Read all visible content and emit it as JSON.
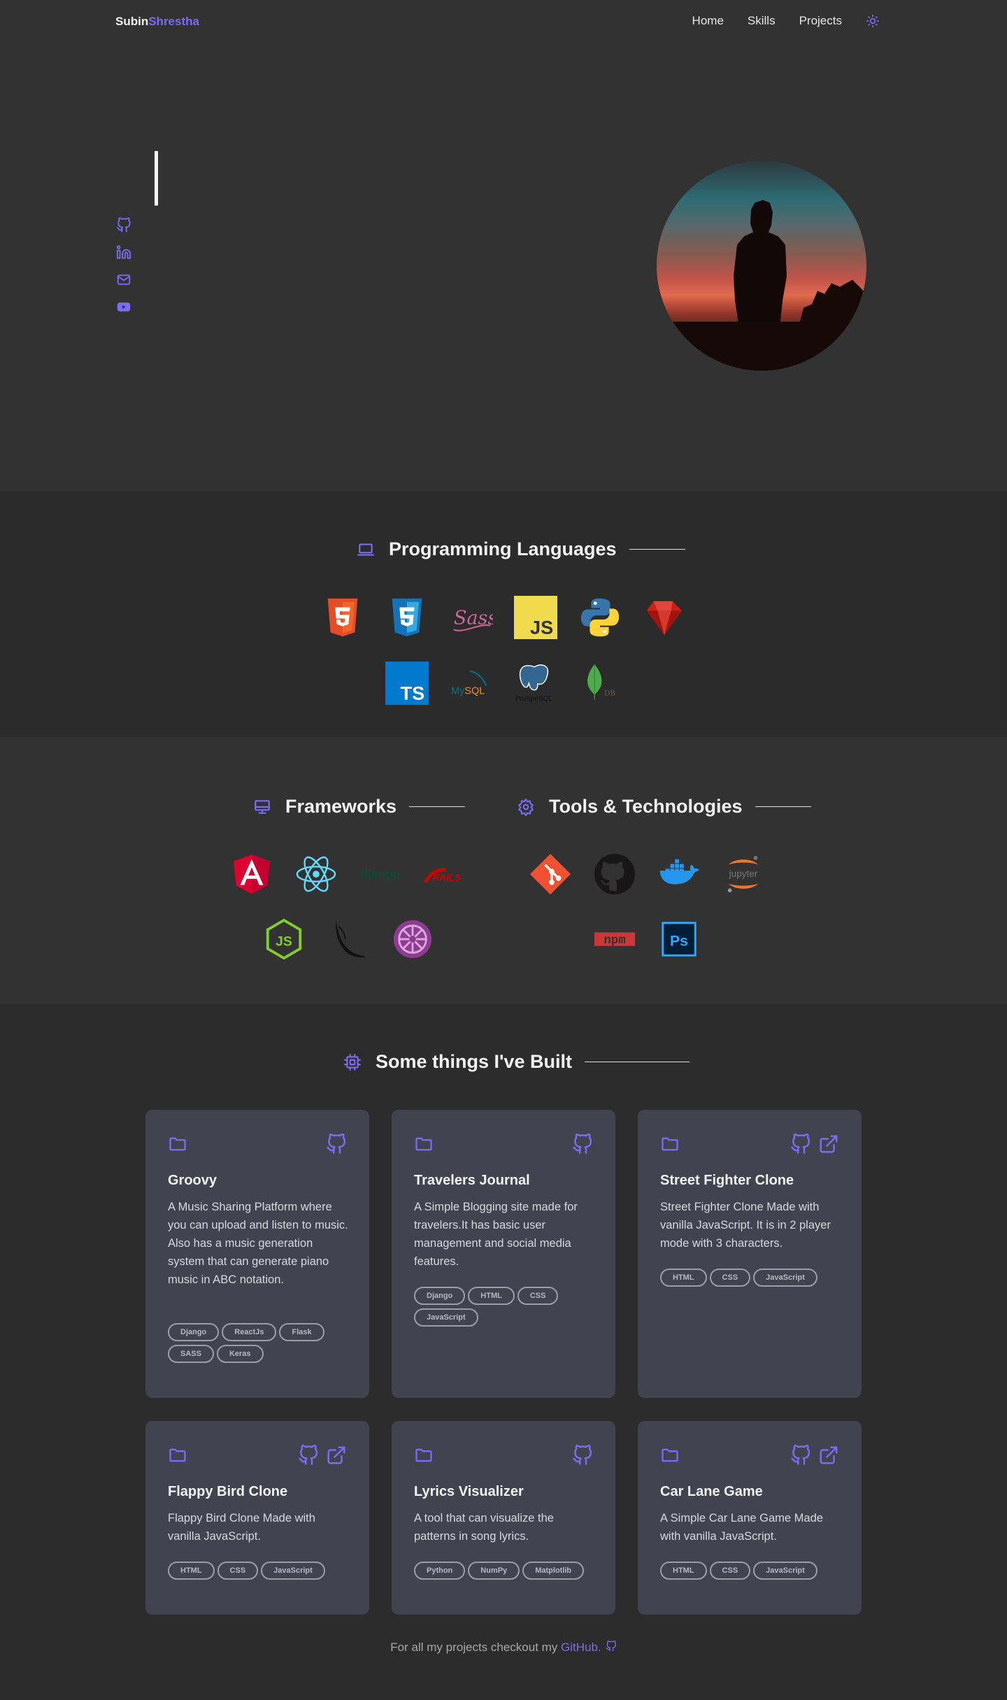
{
  "brand": {
    "first": "Subin",
    "last": "Shrestha"
  },
  "nav": {
    "items": [
      {
        "label": "Home"
      },
      {
        "label": "Skills"
      },
      {
        "label": "Projects"
      }
    ],
    "theme_icon": "sun-icon"
  },
  "hero": {
    "socials": [
      {
        "icon": "github-icon"
      },
      {
        "icon": "linkedin-icon"
      },
      {
        "icon": "mail-icon"
      },
      {
        "icon": "youtube-icon"
      }
    ]
  },
  "sections": {
    "languages": {
      "title": "Programming Languages",
      "icon": "laptop-icon",
      "logos": [
        "html5-logo",
        "css3-logo",
        "sass-logo",
        "javascript-logo",
        "python-logo",
        "ruby-logo",
        "typescript-logo",
        "mysql-logo",
        "postgresql-logo",
        "mongodb-logo"
      ]
    },
    "frameworks": {
      "title": "Frameworks",
      "icon": "desktop-icon",
      "logos": [
        "angular-logo",
        "react-logo",
        "django-logo",
        "rails-logo",
        "nodejs-logo",
        "flask-logo",
        "keras-logo"
      ]
    },
    "tools": {
      "title": "Tools & Technologies",
      "icon": "gear-icon",
      "logos": [
        "git-logo",
        "github-logo",
        "docker-logo",
        "jupyter-logo",
        "npm-logo",
        "photoshop-logo"
      ]
    },
    "projects": {
      "title": "Some things I've Built",
      "icon": "chip-icon"
    }
  },
  "logo_text": {
    "sass": "Sass",
    "js": "JS",
    "ts": "TS",
    "mysql_a": "My",
    "mysql_b": "SQL",
    "postgres": "PostgreSQL",
    "mongo": "DB",
    "django": "django",
    "rails": "RAILS",
    "jupyter": "jupyter",
    "npm": "npm",
    "ps": "Ps"
  },
  "projects": [
    {
      "title": "Groovy",
      "desc": "A Music Sharing Platform where you can upload and listen to music. Also has a music generation system that can generate piano music in ABC notation.",
      "tags": [
        "Django",
        "ReactJs",
        "Flask",
        "SASS",
        "Keras"
      ],
      "links": [
        "github-icon"
      ]
    },
    {
      "title": "Travelers Journal",
      "desc": "A Simple Blogging site made for travelers.It has basic user management and social media features.",
      "tags": [
        "Django",
        "HTML",
        "CSS",
        "JavaScript"
      ],
      "links": [
        "github-icon"
      ]
    },
    {
      "title": "Street Fighter Clone",
      "desc": "Street Fighter Clone Made with vanilla JavaScript. It is in 2 player mode with 3 characters.",
      "tags": [
        "HTML",
        "CSS",
        "JavaScript"
      ],
      "links": [
        "github-icon",
        "external-link-icon"
      ]
    },
    {
      "title": "Flappy Bird Clone",
      "desc": "Flappy Bird Clone Made with vanilla JavaScript.",
      "tags": [
        "HTML",
        "CSS",
        "JavaScript"
      ],
      "links": [
        "github-icon",
        "external-link-icon"
      ]
    },
    {
      "title": "Lyrics Visualizer",
      "desc": "A tool that can visualize the patterns in song lyrics.",
      "tags": [
        "Python",
        "NumPy",
        "Matplotlib"
      ],
      "links": [
        "github-icon"
      ]
    },
    {
      "title": "Car Lane Game",
      "desc": "A Simple Car Lane Game Made with vanilla JavaScript.",
      "tags": [
        "HTML",
        "CSS",
        "JavaScript"
      ],
      "links": [
        "github-icon",
        "external-link-icon"
      ]
    }
  ],
  "footer": {
    "prefix": "For all my projects checkout my",
    "link": "GitHub."
  },
  "colors": {
    "accent": "#7c6cf0",
    "background": "#323232",
    "card": "#434350"
  }
}
